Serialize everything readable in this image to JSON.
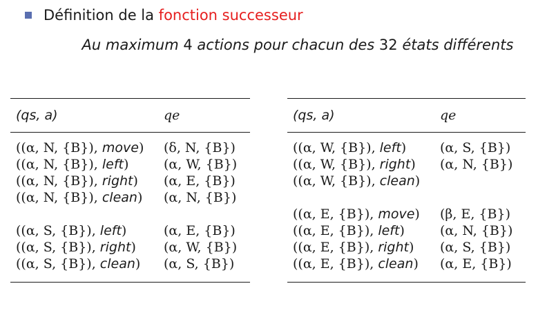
{
  "heading": {
    "prefix": "Définition de la ",
    "highlight": "fonction successeur",
    "highlight_color": "#e61e1e",
    "bullet_color": "#5a6fb0"
  },
  "subtitle": {
    "part1": "Au maximum ",
    "num1": "4",
    "part2": " actions pour chacun des ",
    "num2": "32",
    "part3": " états différents"
  },
  "tables": {
    "left": {
      "header": [
        "(qs, a)",
        "qe"
      ],
      "rows": [
        {
          "state": "((α, N, {B}), ",
          "action": "move",
          "close": ")",
          "result": "(δ, N, {B})"
        },
        {
          "state": "((α, N, {B}), ",
          "action": "left",
          "close": ")",
          "result": "(α, W, {B})"
        },
        {
          "state": "((α, N, {B}), ",
          "action": "right",
          "close": ")",
          "result": "(α, E, {B})"
        },
        {
          "state": "((α, N, {B}), ",
          "action": "clean",
          "close": ")",
          "result": "(α, N, {B})"
        },
        {
          "state": "((α, S, {B}), ",
          "action": "left",
          "close": ")",
          "result": "(α, E, {B})"
        },
        {
          "state": "((α, S, {B}), ",
          "action": "right",
          "close": ")",
          "result": "(α, W, {B})"
        },
        {
          "state": "((α, S, {B}), ",
          "action": "clean",
          "close": ")",
          "result": "(α, S, {B})"
        }
      ]
    },
    "right": {
      "header": [
        "(qs, a)",
        "qe"
      ],
      "rows": [
        {
          "state": "((α, W, {B}), ",
          "action": "left",
          "close": ")",
          "result": "(α, S, {B})"
        },
        {
          "state": "((α, W, {B}), ",
          "action": "right",
          "close": ")",
          "result": "(α, N, {B})"
        },
        {
          "state": "((α, W, {B}), ",
          "action": "clean",
          "close": ")",
          "result": ""
        },
        {
          "state": "((α, E, {B}), ",
          "action": "move",
          "close": ")",
          "result": "(β, E, {B})"
        },
        {
          "state": "((α, E, {B}), ",
          "action": "left",
          "close": ")",
          "result": "(α, N, {B})"
        },
        {
          "state": "((α, E, {B}), ",
          "action": "right",
          "close": ")",
          "result": "(α, S, {B})"
        },
        {
          "state": "((α, E, {B}), ",
          "action": "clean",
          "close": ")",
          "result": "(α, E, {B})"
        }
      ]
    }
  }
}
